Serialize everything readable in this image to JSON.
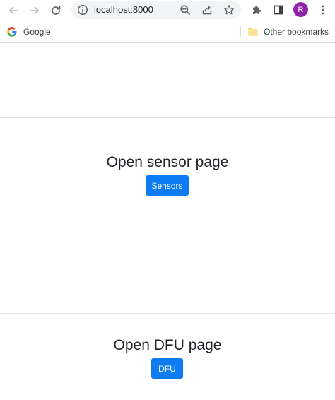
{
  "browser": {
    "url": "localhost:8000",
    "profile_initial": "R",
    "bookmarks": {
      "google_label": "Google",
      "other_label": "Other bookmarks"
    },
    "icons": {
      "back": "arrow-left-icon",
      "forward": "arrow-right-icon",
      "reload": "reload-icon",
      "info": "info-icon",
      "zoom": "zoom-out-icon",
      "share": "share-icon",
      "bookmark": "star-icon",
      "extensions": "puzzle-icon",
      "side_panel": "side-panel-icon",
      "menu": "kebab-menu-icon"
    },
    "colors": {
      "avatar": "#8e24aa"
    }
  },
  "page": {
    "sensor_section": {
      "title": "Open sensor page",
      "button_label": "Sensors"
    },
    "dfu_section": {
      "title": "Open DFU page",
      "button_label": "DFU"
    },
    "colors": {
      "button_bg": "#0d7bf2",
      "title_text": "#212529"
    }
  }
}
